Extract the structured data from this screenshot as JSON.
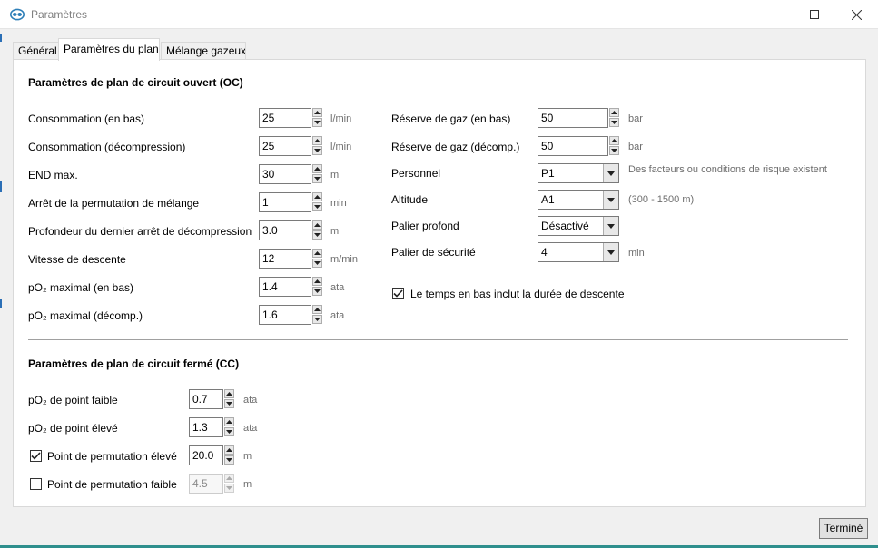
{
  "window": {
    "title": "Paramètres",
    "icon": "dive-mask-icon"
  },
  "tabs": [
    {
      "label": "Général",
      "active": false
    },
    {
      "label": "Paramètres du plan",
      "active": true
    },
    {
      "label": "Mélange gazeux",
      "active": false
    }
  ],
  "oc": {
    "title": "Paramètres de plan de circuit ouvert (OC)",
    "left_rows": [
      {
        "label": "Consommation (en bas)",
        "value": "25",
        "unit": "l/min"
      },
      {
        "label": "Consommation (décompression)",
        "value": "25",
        "unit": "l/min"
      },
      {
        "label": "END max.",
        "value": "30",
        "unit": "m"
      },
      {
        "label": "Arrêt de la permutation de mélange",
        "value": "1",
        "unit": "min"
      },
      {
        "label": "Profondeur du dernier arrêt de décompression",
        "value": "3.0",
        "unit": "m"
      },
      {
        "label": "Vitesse de descente",
        "value": "12",
        "unit": "m/min"
      },
      {
        "label": "pO₂ maximal (en bas)",
        "value": "1.4",
        "unit": "ata"
      },
      {
        "label": "pO₂ maximal (décomp.)",
        "value": "1.6",
        "unit": "ata"
      }
    ],
    "right_rows": [
      {
        "label": "Réserve de gaz (en bas)",
        "value": "50",
        "unit": "bar",
        "control": "spin"
      },
      {
        "label": "Réserve de gaz (décomp.)",
        "value": "50",
        "unit": "bar",
        "control": "spin"
      },
      {
        "label": "Personnel",
        "value": "P1",
        "note": "Des facteurs ou conditions de risque existent",
        "control": "combo"
      },
      {
        "label": "Altitude",
        "value": "A1",
        "note": "(300 - 1500 m)",
        "control": "combo"
      },
      {
        "label": "Palier profond",
        "value": "Désactivé",
        "control": "combo"
      },
      {
        "label": "Palier de sécurité",
        "value": "4",
        "unit": "min",
        "control": "combo"
      }
    ],
    "bottom_time_checkbox": {
      "label": "Le temps en bas inclut la durée de descente",
      "checked": true
    }
  },
  "cc": {
    "title": "Paramètres de plan de circuit fermé (CC)",
    "rows": [
      {
        "label": "pO₂ de point faible",
        "value": "0.7",
        "unit": "ata"
      },
      {
        "label": "pO₂ de point élevé",
        "value": "1.3",
        "unit": "ata"
      },
      {
        "label": "Point de permutation élevé",
        "value": "20.0",
        "unit": "m",
        "checkbox": true,
        "checked": true
      },
      {
        "label": "Point de permutation faible",
        "value": "4.5",
        "unit": "m",
        "checkbox": true,
        "checked": false
      }
    ]
  },
  "footer": {
    "done_label": "Terminé"
  },
  "colors": {
    "accent": "#2b6fb6",
    "bottom_bar": "#2f8f8d"
  }
}
